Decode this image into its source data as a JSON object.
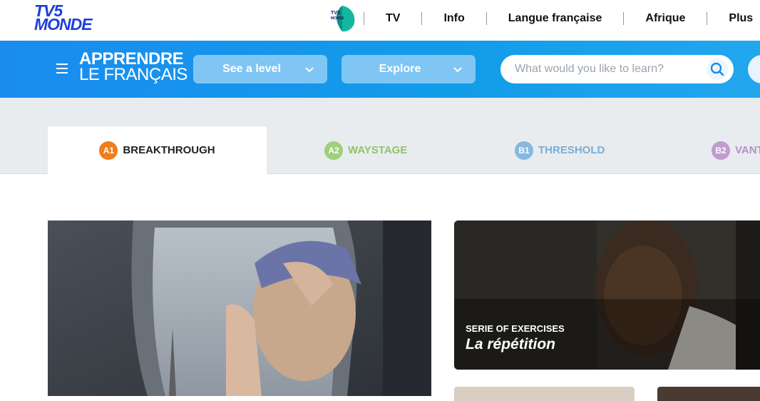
{
  "topbar": {
    "logo_line1": "TV5",
    "logo_line2": "MONDE",
    "plus_badge_text": "TV5 MONDE PLUS",
    "nav": [
      "TV",
      "Info",
      "Langue française",
      "Afrique",
      "Plus"
    ]
  },
  "header": {
    "brand_line1": "APPRENDRE",
    "brand_line2": "LE FRANÇAIS",
    "level_dropdown": "See a level",
    "explore_dropdown": "Explore",
    "search_placeholder": "What would you like to learn?"
  },
  "levels": [
    {
      "code": "A1",
      "name": "BREAKTHROUGH",
      "color": "#f07d1a",
      "active": true
    },
    {
      "code": "A2",
      "name": "WAYSTAGE",
      "color": "#9fd07a",
      "active": false
    },
    {
      "code": "B1",
      "name": "THRESHOLD",
      "color": "#86b8e0",
      "active": false
    },
    {
      "code": "B2",
      "name": "VANTAGE",
      "color": "#c29bd0",
      "active": false
    }
  ],
  "cards": {
    "featured": {
      "category": "SERIE OF EXERCISES",
      "title": "La répétition"
    }
  },
  "colors": {
    "primary_blue": "#1a8cf0",
    "dropdown_bg": "#7fc6f5",
    "logo_blue": "#1f3fd9"
  }
}
